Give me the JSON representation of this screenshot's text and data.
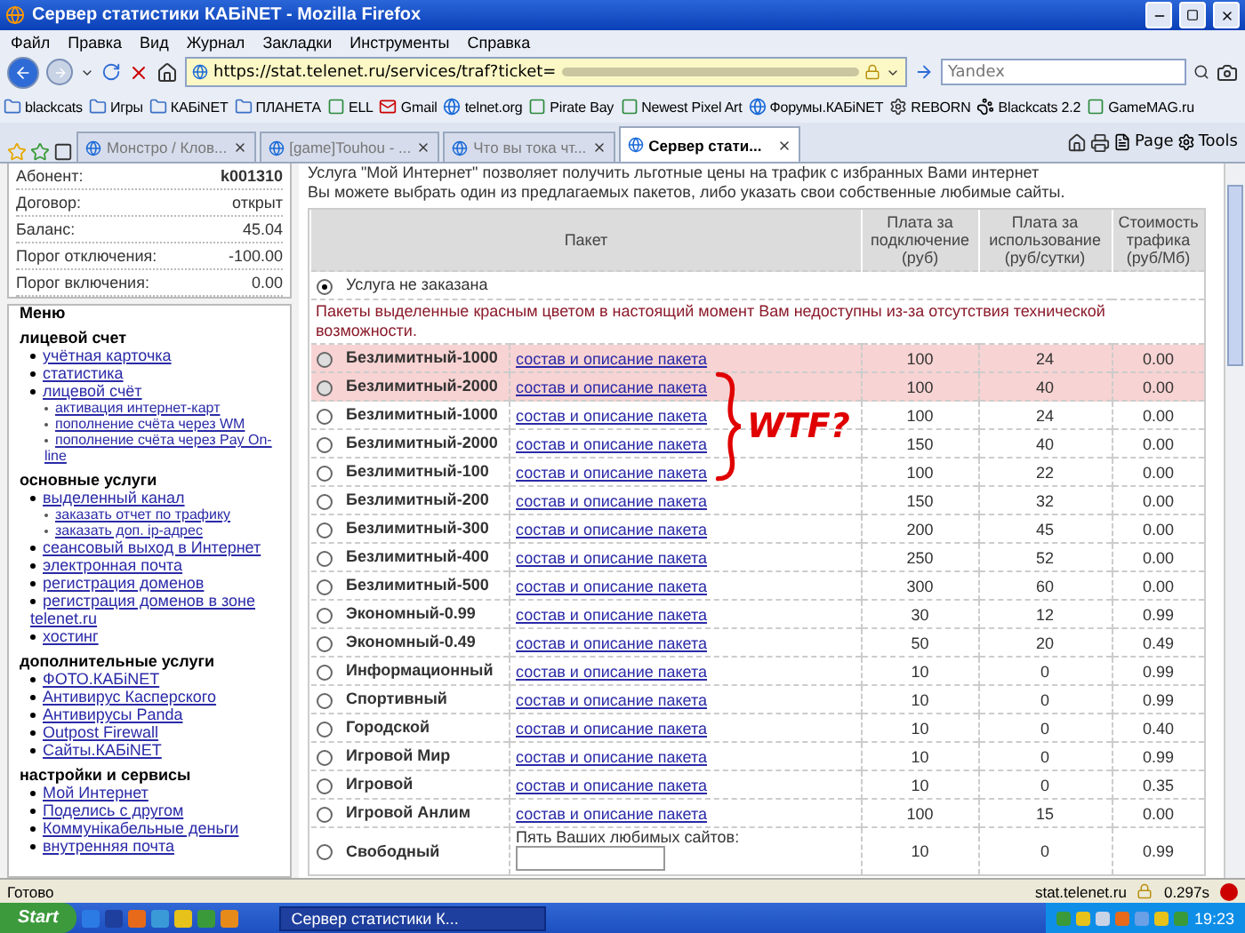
{
  "window": {
    "title": "Сервер статистики КАБiNET - Mozilla Firefox"
  },
  "menu": [
    "Файл",
    "Правка",
    "Вид",
    "Журнал",
    "Закладки",
    "Инструменты",
    "Справка"
  ],
  "address": {
    "value": "https://stat.telenet.ru/services/traf?ticket=",
    "search_placeholder": "Yandex"
  },
  "bookmarks": [
    {
      "label": "blackcats",
      "kind": "folder"
    },
    {
      "label": "Игры",
      "kind": "folder"
    },
    {
      "label": "КАБiNET",
      "kind": "folder"
    },
    {
      "label": "ПЛАНЕТА",
      "kind": "folder"
    },
    {
      "label": "ELL",
      "kind": "site"
    },
    {
      "label": "Gmail",
      "kind": "mail"
    },
    {
      "label": "telnet.org",
      "kind": "globe"
    },
    {
      "label": "Pirate Bay",
      "kind": "site"
    },
    {
      "label": "Newest Pixel Art",
      "kind": "site"
    },
    {
      "label": "Форумы.КАБiNET",
      "kind": "globe"
    },
    {
      "label": "REBORN",
      "kind": "gear"
    },
    {
      "label": "Blackcats 2.2",
      "kind": "paw"
    },
    {
      "label": "GameMAG.ru",
      "kind": "site"
    }
  ],
  "tabs": [
    {
      "label": "Монстро / Клов...",
      "selected": false
    },
    {
      "label": "[game]Touhou - ...",
      "selected": false
    },
    {
      "label": "Что вы тока чт...",
      "selected": false
    },
    {
      "label": "Сервер стати...",
      "selected": true
    }
  ],
  "tab_tools": [
    "Page",
    "Tools"
  ],
  "account": [
    {
      "label": "Абонент:",
      "value": "k001310"
    },
    {
      "label": "Договор:",
      "value": "открыт"
    },
    {
      "label": "Баланс:",
      "value": "45.04"
    },
    {
      "label": "Порог отключения:",
      "value": "-100.00"
    },
    {
      "label": "Порог включения:",
      "value": "0.00"
    }
  ],
  "sidebar_menu": {
    "title": "Меню",
    "sections": [
      {
        "title": "лицевой счет",
        "items": [
          {
            "label": "учётная карточка"
          },
          {
            "label": "статистика"
          },
          {
            "label": "лицевой счёт",
            "children": [
              {
                "label": "активация интернет-карт"
              },
              {
                "label": "пополнение счёта через WM"
              },
              {
                "label": "пополнение счёта через Pay On-line"
              }
            ]
          }
        ]
      },
      {
        "title": "основные услуги",
        "items": [
          {
            "label": "выделенный канал",
            "children": [
              {
                "label": "заказать отчет по трафику"
              },
              {
                "label": "заказать доп. ip-адрес"
              }
            ]
          },
          {
            "label": "сеансовый выход в Интернет"
          },
          {
            "label": "электронная почта"
          },
          {
            "label": "регистрация доменов"
          },
          {
            "label": "регистрация доменов в зоне telenet.ru"
          },
          {
            "label": "хостинг"
          }
        ]
      },
      {
        "title": "дополнительные услуги",
        "items": [
          {
            "label": "ФОТО.КАБiNET"
          },
          {
            "label": "Антивирус Касперского"
          },
          {
            "label": "Антивирусы Panda"
          },
          {
            "label": "Outpost Firewall"
          },
          {
            "label": "Сайты.КАБiNET"
          }
        ]
      },
      {
        "title": "настройки и сервисы",
        "items": [
          {
            "label": "Мой Интернет"
          },
          {
            "label": "Поделись с другом"
          },
          {
            "label": "Коммунікабельные деньги"
          },
          {
            "label": "внутренняя почта"
          }
        ]
      }
    ]
  },
  "intro": [
    "Услуга \"Мой Интернет\" позволяет получить льготные цены на трафик с избранных Вами интернет",
    "Вы можете выбрать один из предлагаемых пакетов, либо указать свои собственные любимые сайты."
  ],
  "table": {
    "columns": [
      "Пакет",
      "Плата за подключение (руб)",
      "Плата за использование (руб/сутки)",
      "Стоимость трафика (руб/Мб)"
    ],
    "none_option": {
      "label": "Услуга не заказана",
      "selected": true
    },
    "notice": "Пакеты выделенные красным цветом в настоящий момент Вам недоступны из-за отсутствия технической возможности.",
    "rows": [
      {
        "name": "Безлимитный-1000",
        "kind": "link",
        "detail": "состав и описание пакета",
        "connect": "100",
        "usage": "24",
        "traffic": "0.00",
        "unavailable": true,
        "selected": false
      },
      {
        "name": "Безлимитный-2000",
        "kind": "link",
        "detail": "состав и описание пакета",
        "connect": "100",
        "usage": "40",
        "traffic": "0.00",
        "unavailable": true,
        "selected": false
      },
      {
        "name": "Безлимитный-1000",
        "kind": "link",
        "detail": "состав и описание пакета",
        "connect": "100",
        "usage": "24",
        "traffic": "0.00",
        "unavailable": false,
        "selected": false
      },
      {
        "name": "Безлимитный-2000",
        "kind": "link",
        "detail": "состав и описание пакета",
        "connect": "150",
        "usage": "40",
        "traffic": "0.00",
        "unavailable": false,
        "selected": false
      },
      {
        "name": "Безлимитный-100",
        "kind": "link",
        "detail": "состав и описание пакета",
        "connect": "100",
        "usage": "22",
        "traffic": "0.00",
        "unavailable": false,
        "selected": false
      },
      {
        "name": "Безлимитный-200",
        "kind": "link",
        "detail": "состав и описание пакета",
        "connect": "150",
        "usage": "32",
        "traffic": "0.00",
        "unavailable": false,
        "selected": false
      },
      {
        "name": "Безлимитный-300",
        "kind": "link",
        "detail": "состав и описание пакета",
        "connect": "200",
        "usage": "45",
        "traffic": "0.00",
        "unavailable": false,
        "selected": false
      },
      {
        "name": "Безлимитный-400",
        "kind": "link",
        "detail": "состав и описание пакета",
        "connect": "250",
        "usage": "52",
        "traffic": "0.00",
        "unavailable": false,
        "selected": false
      },
      {
        "name": "Безлимитный-500",
        "kind": "link",
        "detail": "состав и описание пакета",
        "connect": "300",
        "usage": "60",
        "traffic": "0.00",
        "unavailable": false,
        "selected": false
      },
      {
        "name": "Экономный-0.99",
        "kind": "link",
        "detail": "состав и описание пакета",
        "connect": "30",
        "usage": "12",
        "traffic": "0.99",
        "unavailable": false,
        "selected": false
      },
      {
        "name": "Экономный-0.49",
        "kind": "link",
        "detail": "состав и описание пакета",
        "connect": "50",
        "usage": "20",
        "traffic": "0.49",
        "unavailable": false,
        "selected": false
      },
      {
        "name": "Информационный",
        "kind": "link",
        "detail": "состав и описание пакета",
        "connect": "10",
        "usage": "0",
        "traffic": "0.99",
        "unavailable": false,
        "selected": false
      },
      {
        "name": "Спортивный",
        "kind": "link",
        "detail": "состав и описание пакета",
        "connect": "10",
        "usage": "0",
        "traffic": "0.99",
        "unavailable": false,
        "selected": false
      },
      {
        "name": "Городской",
        "kind": "link",
        "detail": "состав и описание пакета",
        "connect": "10",
        "usage": "0",
        "traffic": "0.40",
        "unavailable": false,
        "selected": false
      },
      {
        "name": "Игровой Мир",
        "kind": "link",
        "detail": "состав и описание пакета",
        "connect": "10",
        "usage": "0",
        "traffic": "0.99",
        "unavailable": false,
        "selected": false
      },
      {
        "name": "Игровой",
        "kind": "link",
        "detail": "состав и описание пакета",
        "connect": "10",
        "usage": "0",
        "traffic": "0.35",
        "unavailable": false,
        "selected": false
      },
      {
        "name": "Игровой Анлим",
        "kind": "link",
        "detail": "состав и описание пакета",
        "connect": "100",
        "usage": "15",
        "traffic": "0.00",
        "unavailable": false,
        "selected": false
      },
      {
        "name": "Свободный",
        "kind": "sites",
        "detail": "Пять Ваших любимых сайтов:",
        "connect": "10",
        "usage": "0",
        "traffic": "0.99",
        "unavailable": false,
        "selected": false
      }
    ]
  },
  "annotation": {
    "text": "WTF?"
  },
  "status_bar": {
    "text": "Готово",
    "host": "stat.telenet.ru",
    "timing": "0.297s"
  },
  "taskbar": {
    "start": "Start",
    "task": "Сервер статистики К...",
    "clock": "19:23"
  }
}
